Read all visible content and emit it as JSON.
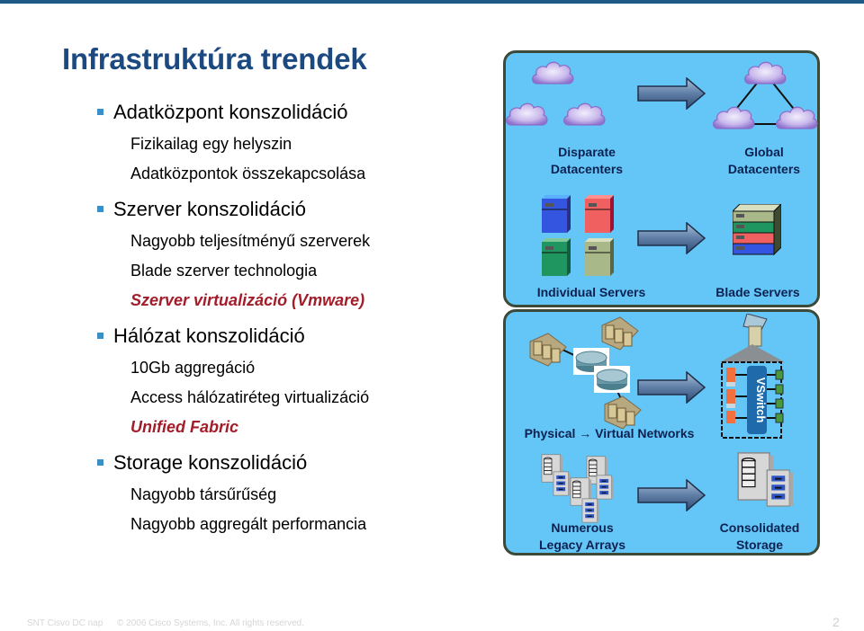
{
  "slide": {
    "title": "Infrastruktúra trendek",
    "bullets": [
      {
        "label": "Adatközpont konszolidáció",
        "items": [
          {
            "text": "Fizikailag egy helyszin",
            "highlight": false
          },
          {
            "text": "Adatközpontok összekapcsolása",
            "highlight": false
          }
        ]
      },
      {
        "label": "Szerver konszolidáció",
        "items": [
          {
            "text": "Nagyobb teljesítményű szerverek",
            "highlight": false
          },
          {
            "text": "Blade szerver technologia",
            "highlight": false
          },
          {
            "text": "Szerver virtualizáció (Vmware)",
            "highlight": true
          }
        ]
      },
      {
        "label": "Hálózat konszolidáció",
        "items": [
          {
            "text": "10Gb aggregáció",
            "highlight": false
          },
          {
            "text": "Access hálózatiréteg virtualizáció",
            "highlight": false
          },
          {
            "text": "Unified Fabric",
            "highlight": true
          }
        ]
      },
      {
        "label": "Storage konszolidáció",
        "items": [
          {
            "text": "Nagyobb társűrűség",
            "highlight": false
          },
          {
            "text": "Nagyobb aggregált performancia",
            "highlight": false
          }
        ]
      }
    ]
  },
  "diagram": {
    "rows": [
      {
        "from": [
          "Disparate",
          "Datacenters"
        ],
        "to": [
          "Global",
          "Datacenters"
        ],
        "from_icon": "cloud-icon",
        "to_icon": "cloud-triangle-icon"
      },
      {
        "from": [
          "Individual Servers"
        ],
        "to": [
          "Blade Servers"
        ],
        "from_icon": "server-tower-icon",
        "to_icon": "blade-chassis-icon"
      },
      {
        "from": [
          "Physical → Virtual Networks"
        ],
        "to": [],
        "from_icon": "router-icon",
        "to_icon": "vswitch-icon",
        "vswitch_label": "VSwitch"
      },
      {
        "from": [
          "Numerous",
          "Legacy Arrays"
        ],
        "to": [
          "Consolidated",
          "Storage"
        ],
        "from_icon": "storage-array-icon",
        "to_icon": "storage-array-icon"
      }
    ],
    "colors": {
      "panel_bg": "#63c6f7",
      "panel_border": "#3d4a3a",
      "label": "#0d2150",
      "server_blue": "#3355e0",
      "server_red": "#f06060",
      "server_green": "#1f9560",
      "server_khaki": "#a8b888"
    }
  },
  "footer": {
    "event": "SNT Cisvo DC nap",
    "copyright": "© 2006 Cisco Systems, Inc. All rights reserved.",
    "page_number": "2"
  },
  "theme": {
    "title_color": "#1c4a80",
    "bullet_color": "#3a8fc6",
    "highlight_color": "#a21d2a",
    "top_bar_color": "#1f5a87"
  }
}
